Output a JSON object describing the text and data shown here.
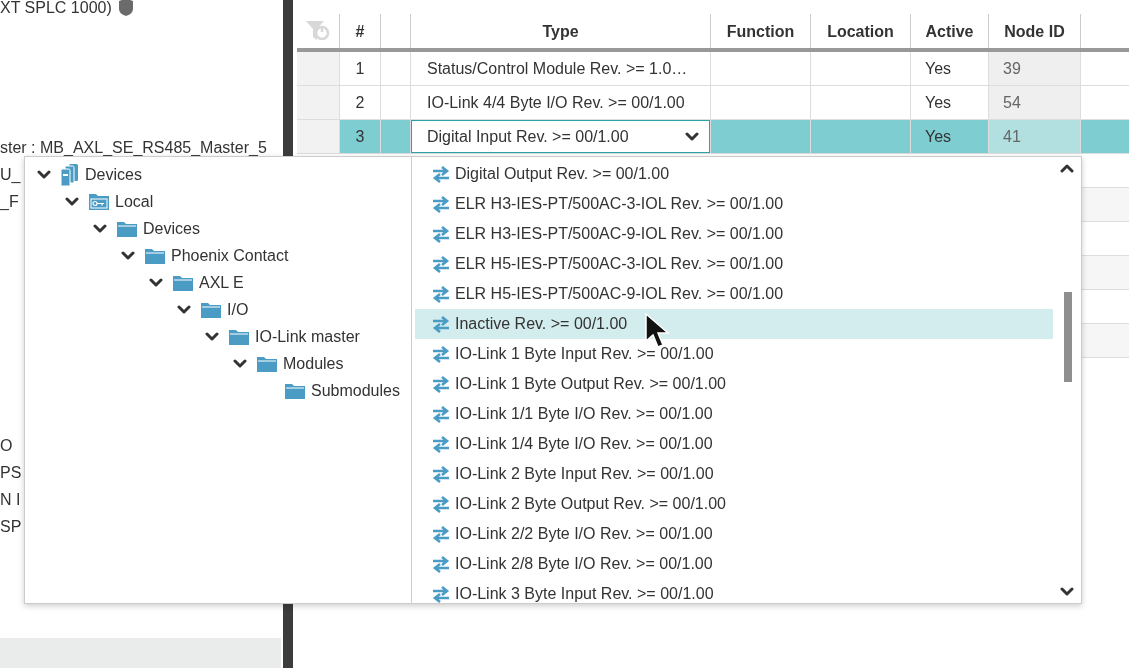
{
  "left_panel": {
    "lines": [
      "XT SPLC 1000)",
      "ster : MB_AXL_SE_RS485_Master_5",
      "U_",
      "_F",
      "O",
      "PS",
      "N I",
      "SP"
    ]
  },
  "table": {
    "columns": [
      "#",
      "",
      "Type",
      "Function",
      "Location",
      "Active",
      "Node ID"
    ],
    "rows": [
      {
        "number": "1",
        "type": "Status/Control Module Rev. >= 1.0…",
        "function": "",
        "location": "",
        "active": "Yes",
        "node_id": "39",
        "selected": false,
        "editing": false
      },
      {
        "number": "2",
        "type": "IO-Link 4/4 Byte I/O Rev. >= 00/1.00",
        "function": "",
        "location": "",
        "active": "Yes",
        "node_id": "54",
        "selected": false,
        "editing": false
      },
      {
        "number": "3",
        "type": "Digital Input Rev. >= 00/1.00",
        "function": "",
        "location": "",
        "active": "Yes",
        "node_id": "41",
        "selected": true,
        "editing": true
      }
    ]
  },
  "type_picker": {
    "tree": [
      {
        "label": "Devices",
        "expanded": true,
        "children": [
          {
            "label": "Local",
            "expanded": true,
            "children": [
              {
                "label": "Devices",
                "expanded": true,
                "children": [
                  {
                    "label": "Phoenix Contact",
                    "expanded": true,
                    "children": [
                      {
                        "label": "AXL E",
                        "expanded": true,
                        "children": [
                          {
                            "label": "I/O",
                            "expanded": true,
                            "children": [
                              {
                                "label": "IO-Link master",
                                "expanded": true,
                                "children": [
                                  {
                                    "label": "Modules",
                                    "expanded": true,
                                    "children": [
                                      {
                                        "label": "Submodules"
                                      }
                                    ]
                                  }
                                ]
                              }
                            ]
                          }
                        ]
                      }
                    ]
                  }
                ]
              }
            ]
          }
        ]
      }
    ],
    "options": [
      {
        "label": "Digital Output Rev. >= 00/1.00",
        "selected": false
      },
      {
        "label": "ELR H3-IES-PT/500AC-3-IOL Rev. >= 00/1.00",
        "selected": false
      },
      {
        "label": "ELR H3-IES-PT/500AC-9-IOL Rev. >= 00/1.00",
        "selected": false
      },
      {
        "label": "ELR H5-IES-PT/500AC-3-IOL Rev. >= 00/1.00",
        "selected": false
      },
      {
        "label": "ELR H5-IES-PT/500AC-9-IOL Rev. >= 00/1.00",
        "selected": false
      },
      {
        "label": "Inactive Rev. >= 00/1.00",
        "selected": true
      },
      {
        "label": "IO-Link 1 Byte Input Rev. >= 00/1.00",
        "selected": false
      },
      {
        "label": "IO-Link 1 Byte Output Rev. >= 00/1.00",
        "selected": false
      },
      {
        "label": "IO-Link 1/1 Byte I/O Rev. >= 00/1.00",
        "selected": false
      },
      {
        "label": "IO-Link 1/4 Byte I/O Rev. >= 00/1.00",
        "selected": false
      },
      {
        "label": "IO-Link 2 Byte Input Rev. >= 00/1.00",
        "selected": false
      },
      {
        "label": "IO-Link 2 Byte Output Rev. >= 00/1.00",
        "selected": false
      },
      {
        "label": "IO-Link 2/2 Byte I/O Rev. >= 00/1.00",
        "selected": false
      },
      {
        "label": "IO-Link 2/8 Byte I/O Rev. >= 00/1.00",
        "selected": false
      },
      {
        "label": "IO-Link 3 Byte Input Rev. >= 00/1.00",
        "selected": false
      }
    ]
  }
}
